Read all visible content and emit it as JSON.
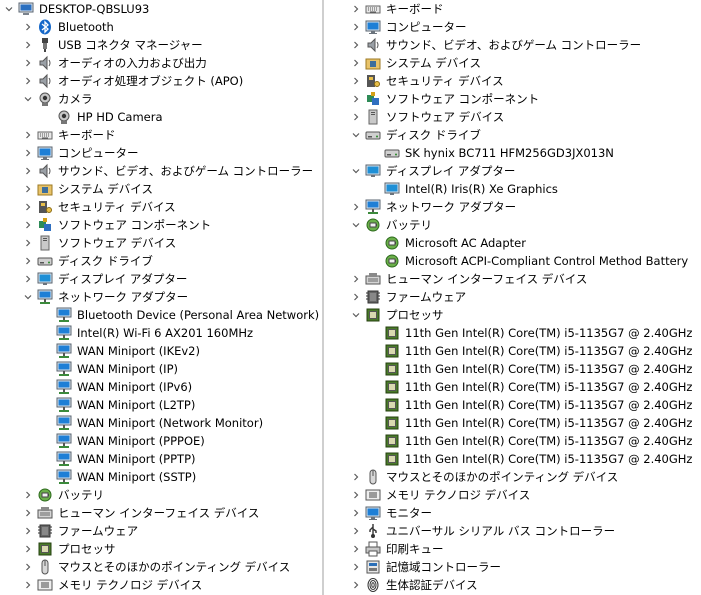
{
  "left_pane": {
    "rows": [
      {
        "label": "DESKTOP-QBSLU93",
        "level": 0,
        "expander": "expanded",
        "icon": "computer-icon"
      },
      {
        "label": "Bluetooth",
        "level": 1,
        "expander": "collapsed",
        "icon": "bluetooth-icon"
      },
      {
        "label": "USB コネクタ マネージャー",
        "level": 1,
        "expander": "collapsed",
        "icon": "usb-connector-icon"
      },
      {
        "label": "オーディオの入力および出力",
        "level": 1,
        "expander": "collapsed",
        "icon": "speaker-icon"
      },
      {
        "label": "オーディオ処理オブジェクト (APO)",
        "level": 1,
        "expander": "collapsed",
        "icon": "speaker-icon"
      },
      {
        "label": "カメラ",
        "level": 1,
        "expander": "expanded",
        "icon": "camera-icon"
      },
      {
        "label": "HP HD Camera",
        "level": 2,
        "expander": "none",
        "icon": "camera-icon"
      },
      {
        "label": "キーボード",
        "level": 1,
        "expander": "collapsed",
        "icon": "keyboard-icon"
      },
      {
        "label": "コンピューター",
        "level": 1,
        "expander": "collapsed",
        "icon": "monitor-icon"
      },
      {
        "label": "サウンド、ビデオ、およびゲーム コントローラー",
        "level": 1,
        "expander": "collapsed",
        "icon": "speaker-icon"
      },
      {
        "label": "システム デバイス",
        "level": 1,
        "expander": "collapsed",
        "icon": "folder-chip-icon"
      },
      {
        "label": "セキュリティ デバイス",
        "level": 1,
        "expander": "collapsed",
        "icon": "key-icon"
      },
      {
        "label": "ソフトウェア コンポーネント",
        "level": 1,
        "expander": "collapsed",
        "icon": "puzzle-icon"
      },
      {
        "label": "ソフトウェア デバイス",
        "level": 1,
        "expander": "collapsed",
        "icon": "tower-icon"
      },
      {
        "label": "ディスク ドライブ",
        "level": 1,
        "expander": "collapsed",
        "icon": "disk-icon"
      },
      {
        "label": "ディスプレイ アダプター",
        "level": 1,
        "expander": "collapsed",
        "icon": "display-adapter-icon"
      },
      {
        "label": "ネットワーク アダプター",
        "level": 1,
        "expander": "expanded",
        "icon": "network-icon"
      },
      {
        "label": "Bluetooth Device (Personal Area Network)",
        "level": 2,
        "expander": "none",
        "icon": "network-icon"
      },
      {
        "label": "Intel(R) Wi-Fi 6 AX201 160MHz",
        "level": 2,
        "expander": "none",
        "icon": "network-icon"
      },
      {
        "label": "WAN Miniport (IKEv2)",
        "level": 2,
        "expander": "none",
        "icon": "network-icon"
      },
      {
        "label": "WAN Miniport (IP)",
        "level": 2,
        "expander": "none",
        "icon": "network-icon"
      },
      {
        "label": "WAN Miniport (IPv6)",
        "level": 2,
        "expander": "none",
        "icon": "network-icon"
      },
      {
        "label": "WAN Miniport (L2TP)",
        "level": 2,
        "expander": "none",
        "icon": "network-icon"
      },
      {
        "label": "WAN Miniport (Network Monitor)",
        "level": 2,
        "expander": "none",
        "icon": "network-icon"
      },
      {
        "label": "WAN Miniport (PPPOE)",
        "level": 2,
        "expander": "none",
        "icon": "network-icon"
      },
      {
        "label": "WAN Miniport (PPTP)",
        "level": 2,
        "expander": "none",
        "icon": "network-icon"
      },
      {
        "label": "WAN Miniport (SSTP)",
        "level": 2,
        "expander": "none",
        "icon": "network-icon"
      },
      {
        "label": "バッテリ",
        "level": 1,
        "expander": "collapsed",
        "icon": "battery-icon"
      },
      {
        "label": "ヒューマン インターフェイス デバイス",
        "level": 1,
        "expander": "collapsed",
        "icon": "hid-icon"
      },
      {
        "label": "ファームウェア",
        "level": 1,
        "expander": "collapsed",
        "icon": "firmware-icon"
      },
      {
        "label": "プロセッサ",
        "level": 1,
        "expander": "collapsed",
        "icon": "processor-icon"
      },
      {
        "label": "マウスとそのほかのポインティング デバイス",
        "level": 1,
        "expander": "collapsed",
        "icon": "mouse-icon"
      },
      {
        "label": "メモリ テクノロジ デバイス",
        "level": 1,
        "expander": "collapsed",
        "icon": "memory-icon"
      }
    ]
  },
  "right_pane": {
    "rows": [
      {
        "label": "キーボード",
        "level": 1,
        "expander": "collapsed",
        "icon": "keyboard-icon"
      },
      {
        "label": "コンピューター",
        "level": 1,
        "expander": "collapsed",
        "icon": "monitor-icon"
      },
      {
        "label": "サウンド、ビデオ、およびゲーム コントローラー",
        "level": 1,
        "expander": "collapsed",
        "icon": "speaker-icon"
      },
      {
        "label": "システム デバイス",
        "level": 1,
        "expander": "collapsed",
        "icon": "folder-chip-icon"
      },
      {
        "label": "セキュリティ デバイス",
        "level": 1,
        "expander": "collapsed",
        "icon": "key-icon"
      },
      {
        "label": "ソフトウェア コンポーネント",
        "level": 1,
        "expander": "collapsed",
        "icon": "puzzle-icon"
      },
      {
        "label": "ソフトウェア デバイス",
        "level": 1,
        "expander": "collapsed",
        "icon": "tower-icon"
      },
      {
        "label": "ディスク ドライブ",
        "level": 1,
        "expander": "expanded",
        "icon": "disk-icon"
      },
      {
        "label": "SK hynix BC711 HFM256GD3JX013N",
        "level": 2,
        "expander": "none",
        "icon": "disk-icon"
      },
      {
        "label": "ディスプレイ アダプター",
        "level": 1,
        "expander": "expanded",
        "icon": "display-adapter-icon"
      },
      {
        "label": "Intel(R) Iris(R) Xe Graphics",
        "level": 2,
        "expander": "none",
        "icon": "display-adapter-icon"
      },
      {
        "label": "ネットワーク アダプター",
        "level": 1,
        "expander": "collapsed",
        "icon": "network-icon"
      },
      {
        "label": "バッテリ",
        "level": 1,
        "expander": "expanded",
        "icon": "battery-icon"
      },
      {
        "label": "Microsoft AC Adapter",
        "level": 2,
        "expander": "none",
        "icon": "battery-icon"
      },
      {
        "label": "Microsoft ACPI-Compliant Control Method Battery",
        "level": 2,
        "expander": "none",
        "icon": "battery-icon"
      },
      {
        "label": "ヒューマン インターフェイス デバイス",
        "level": 1,
        "expander": "collapsed",
        "icon": "hid-icon"
      },
      {
        "label": "ファームウェア",
        "level": 1,
        "expander": "collapsed",
        "icon": "firmware-icon"
      },
      {
        "label": "プロセッサ",
        "level": 1,
        "expander": "expanded",
        "icon": "processor-icon"
      },
      {
        "label": "11th Gen Intel(R) Core(TM) i5-1135G7 @ 2.40GHz",
        "level": 2,
        "expander": "none",
        "icon": "processor-icon"
      },
      {
        "label": "11th Gen Intel(R) Core(TM) i5-1135G7 @ 2.40GHz",
        "level": 2,
        "expander": "none",
        "icon": "processor-icon"
      },
      {
        "label": "11th Gen Intel(R) Core(TM) i5-1135G7 @ 2.40GHz",
        "level": 2,
        "expander": "none",
        "icon": "processor-icon"
      },
      {
        "label": "11th Gen Intel(R) Core(TM) i5-1135G7 @ 2.40GHz",
        "level": 2,
        "expander": "none",
        "icon": "processor-icon"
      },
      {
        "label": "11th Gen Intel(R) Core(TM) i5-1135G7 @ 2.40GHz",
        "level": 2,
        "expander": "none",
        "icon": "processor-icon"
      },
      {
        "label": "11th Gen Intel(R) Core(TM) i5-1135G7 @ 2.40GHz",
        "level": 2,
        "expander": "none",
        "icon": "processor-icon"
      },
      {
        "label": "11th Gen Intel(R) Core(TM) i5-1135G7 @ 2.40GHz",
        "level": 2,
        "expander": "none",
        "icon": "processor-icon"
      },
      {
        "label": "11th Gen Intel(R) Core(TM) i5-1135G7 @ 2.40GHz",
        "level": 2,
        "expander": "none",
        "icon": "processor-icon"
      },
      {
        "label": "マウスとそのほかのポインティング デバイス",
        "level": 1,
        "expander": "collapsed",
        "icon": "mouse-icon"
      },
      {
        "label": "メモリ テクノロジ デバイス",
        "level": 1,
        "expander": "collapsed",
        "icon": "memory-icon"
      },
      {
        "label": "モニター",
        "level": 1,
        "expander": "collapsed",
        "icon": "monitor-icon"
      },
      {
        "label": "ユニバーサル シリアル バス コントローラー",
        "level": 1,
        "expander": "collapsed",
        "icon": "usb-icon"
      },
      {
        "label": "印刷キュー",
        "level": 1,
        "expander": "collapsed",
        "icon": "printer-icon"
      },
      {
        "label": "記憶域コントローラー",
        "level": 1,
        "expander": "collapsed",
        "icon": "storage-controller-icon"
      },
      {
        "label": "生体認証デバイス",
        "level": 1,
        "expander": "collapsed",
        "icon": "fingerprint-icon"
      }
    ]
  },
  "colors": {
    "chevron": "#5a5a5a",
    "divider": "#cfcfcf",
    "monitor_blue": "#1e7fd6",
    "bluetooth_blue": "#1668c9",
    "chip_green": "#4a7a2a"
  }
}
